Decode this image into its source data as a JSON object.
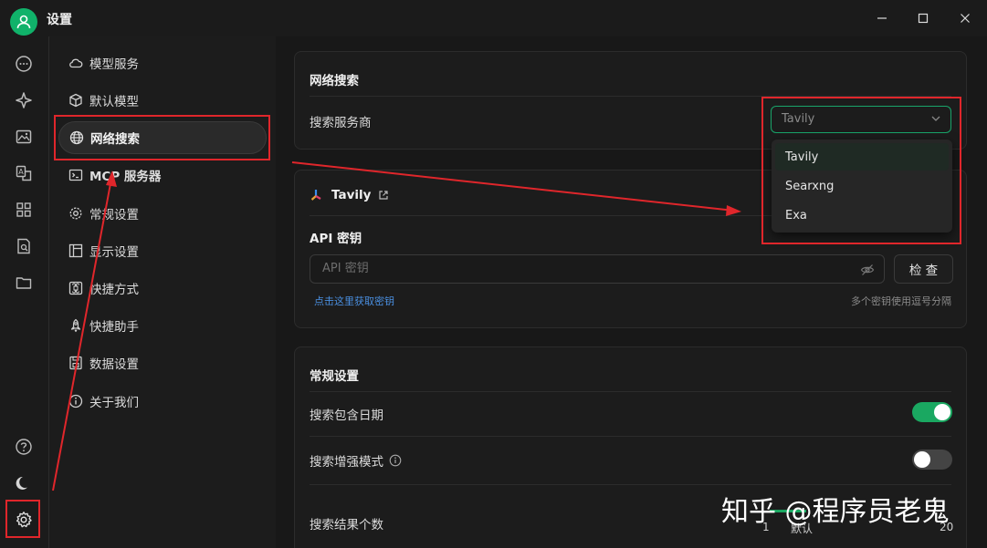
{
  "window": {
    "title": "设置"
  },
  "nav": {
    "items": [
      {
        "label": "模型服务"
      },
      {
        "label": "默认模型"
      },
      {
        "label": "网络搜索"
      },
      {
        "label": "MCP 服务器"
      },
      {
        "label": "常规设置"
      },
      {
        "label": "显示设置"
      },
      {
        "label": "快捷方式"
      },
      {
        "label": "快捷助手"
      },
      {
        "label": "数据设置"
      },
      {
        "label": "关于我们"
      }
    ],
    "active": "网络搜索"
  },
  "web_search": {
    "title": "网络搜索",
    "provider_label": "搜索服务商",
    "provider_value": "Tavily",
    "options": [
      "Tavily",
      "Searxng",
      "Exa"
    ]
  },
  "provider": {
    "name": "Tavily",
    "api_key_label": "API 密钥",
    "api_key_placeholder": "API 密钥",
    "api_key_value": "",
    "check_label": "检 查",
    "get_key_link": "点击这里获取密钥",
    "hint": "多个密钥使用逗号分隔"
  },
  "general": {
    "title": "常规设置",
    "include_date_label": "搜索包含日期",
    "include_date": true,
    "enhanced_label": "搜索增强模式",
    "enhanced": false,
    "result_count_label": "搜索结果个数",
    "slider_min": "1",
    "slider_default": "默认",
    "slider_max": "20"
  },
  "watermark": "知乎 @程序员老鬼",
  "colors": {
    "accent": "#1aa861",
    "annotation": "#e0262b",
    "link": "#4a8fe0"
  }
}
